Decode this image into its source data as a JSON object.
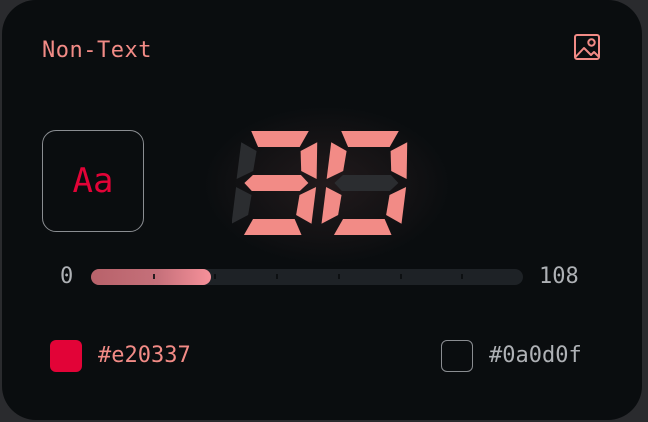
{
  "card": {
    "title": "Non-Text",
    "image_icon": "image-icon"
  },
  "sample": {
    "text": "Aa",
    "color": "#e20337"
  },
  "contrast": {
    "display_value": "30"
  },
  "slider": {
    "min": "0",
    "max": "108",
    "value": 30,
    "tick_count": 7
  },
  "colors": {
    "foreground": {
      "hex": "#e20337",
      "swatch": "#e20337"
    },
    "background": {
      "hex": "#0a0d0f",
      "swatch": "#0a0d0f"
    },
    "accent": "#f28b86"
  }
}
